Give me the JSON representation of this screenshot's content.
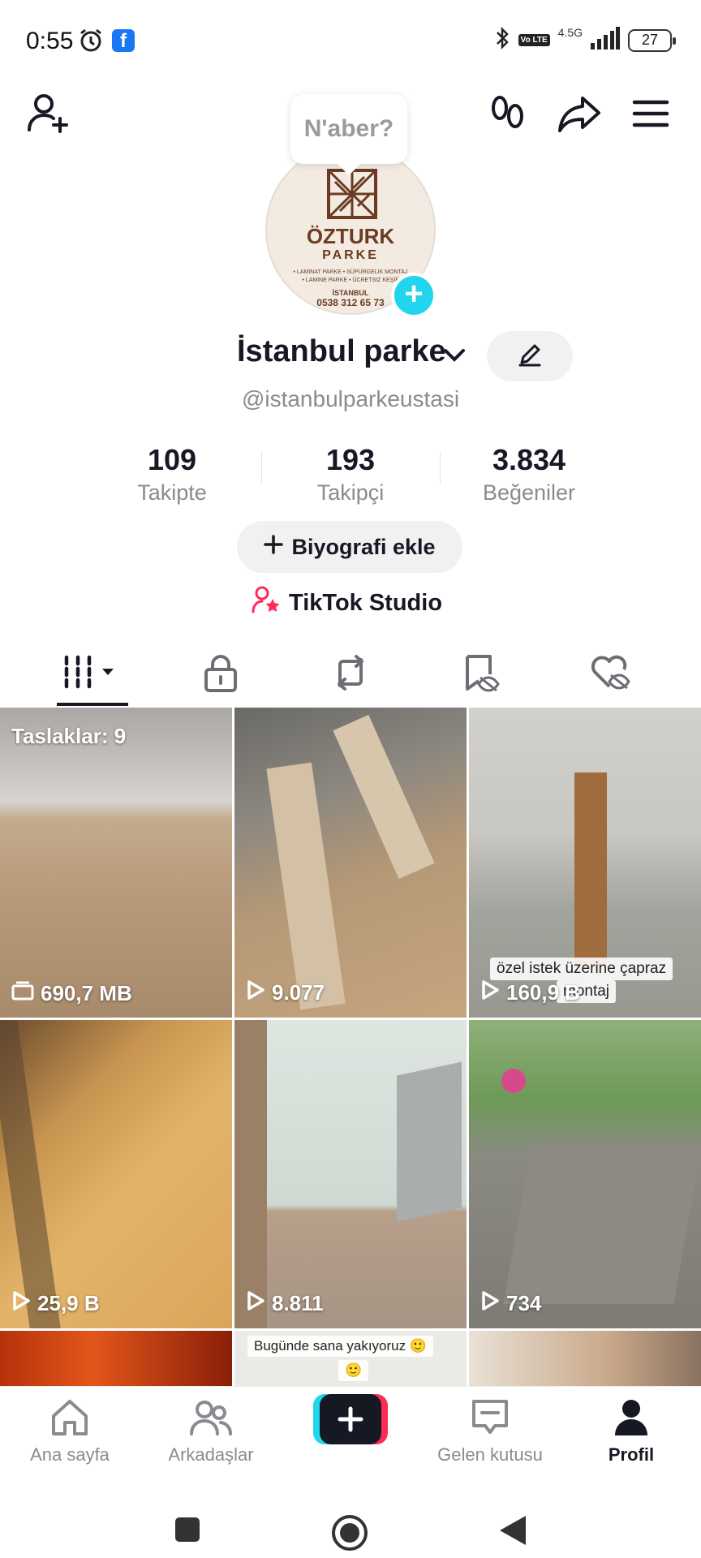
{
  "status_bar": {
    "time": "0:55",
    "network": "4.5G",
    "lte_badge": "Vo LTE",
    "battery": "27"
  },
  "bubble": {
    "text": "N'aber?"
  },
  "avatar": {
    "brand_line1": "ÖZTURK",
    "brand_line2": "PARKE",
    "services_line1": "• LAMINAT PARKE  • SÜPURGELIK MONTAJ",
    "services_line2": "• LAMINE PARKE  • ÜCRETSIZ KEŞİF",
    "city": "İSTANBUL",
    "phone": "0538 312 65 73"
  },
  "profile": {
    "name": "İstanbul parke",
    "handle": "@istanbulparkeustasi"
  },
  "stats": [
    {
      "value": "109",
      "label": "Takipte"
    },
    {
      "value": "193",
      "label": "Takipçi"
    },
    {
      "value": "3.834",
      "label": "Beğeniler"
    }
  ],
  "bio_button": "Biyografi ekle",
  "studio_label": "TikTok Studio",
  "grid": {
    "drafts_label": "Taslaklar: 9",
    "items": [
      {
        "meta": "690,7 MB",
        "icon": "folder-icon"
      },
      {
        "meta": "9.077",
        "icon": "play-icon"
      },
      {
        "meta": "160,9 B",
        "icon": "play-icon",
        "caption_line1": "özel istek üzerine çapraz",
        "caption_line2": "montaj"
      },
      {
        "meta": "25,9 B",
        "icon": "play-icon"
      },
      {
        "meta": "8.811",
        "icon": "play-icon"
      },
      {
        "meta": "734",
        "icon": "play-icon"
      },
      {
        "meta": "",
        "icon": ""
      },
      {
        "meta": "",
        "icon": "",
        "caption_line1": "Bugünde sana yakıyoruz 🙂",
        "caption_line2": "🙂"
      },
      {
        "meta": "",
        "icon": ""
      }
    ]
  },
  "bottom_nav": [
    {
      "label": "Ana sayfa",
      "icon": "home-icon"
    },
    {
      "label": "Arkadaşlar",
      "icon": "friends-icon"
    },
    {
      "label": "",
      "icon": "create-icon"
    },
    {
      "label": "Gelen kutusu",
      "icon": "inbox-icon"
    },
    {
      "label": "Profil",
      "icon": "profile-icon"
    }
  ],
  "colors": {
    "accent_cyan": "#20d5ec",
    "accent_red": "#fe2c55",
    "text_primary": "#161823",
    "text_secondary": "#8a8b91"
  }
}
